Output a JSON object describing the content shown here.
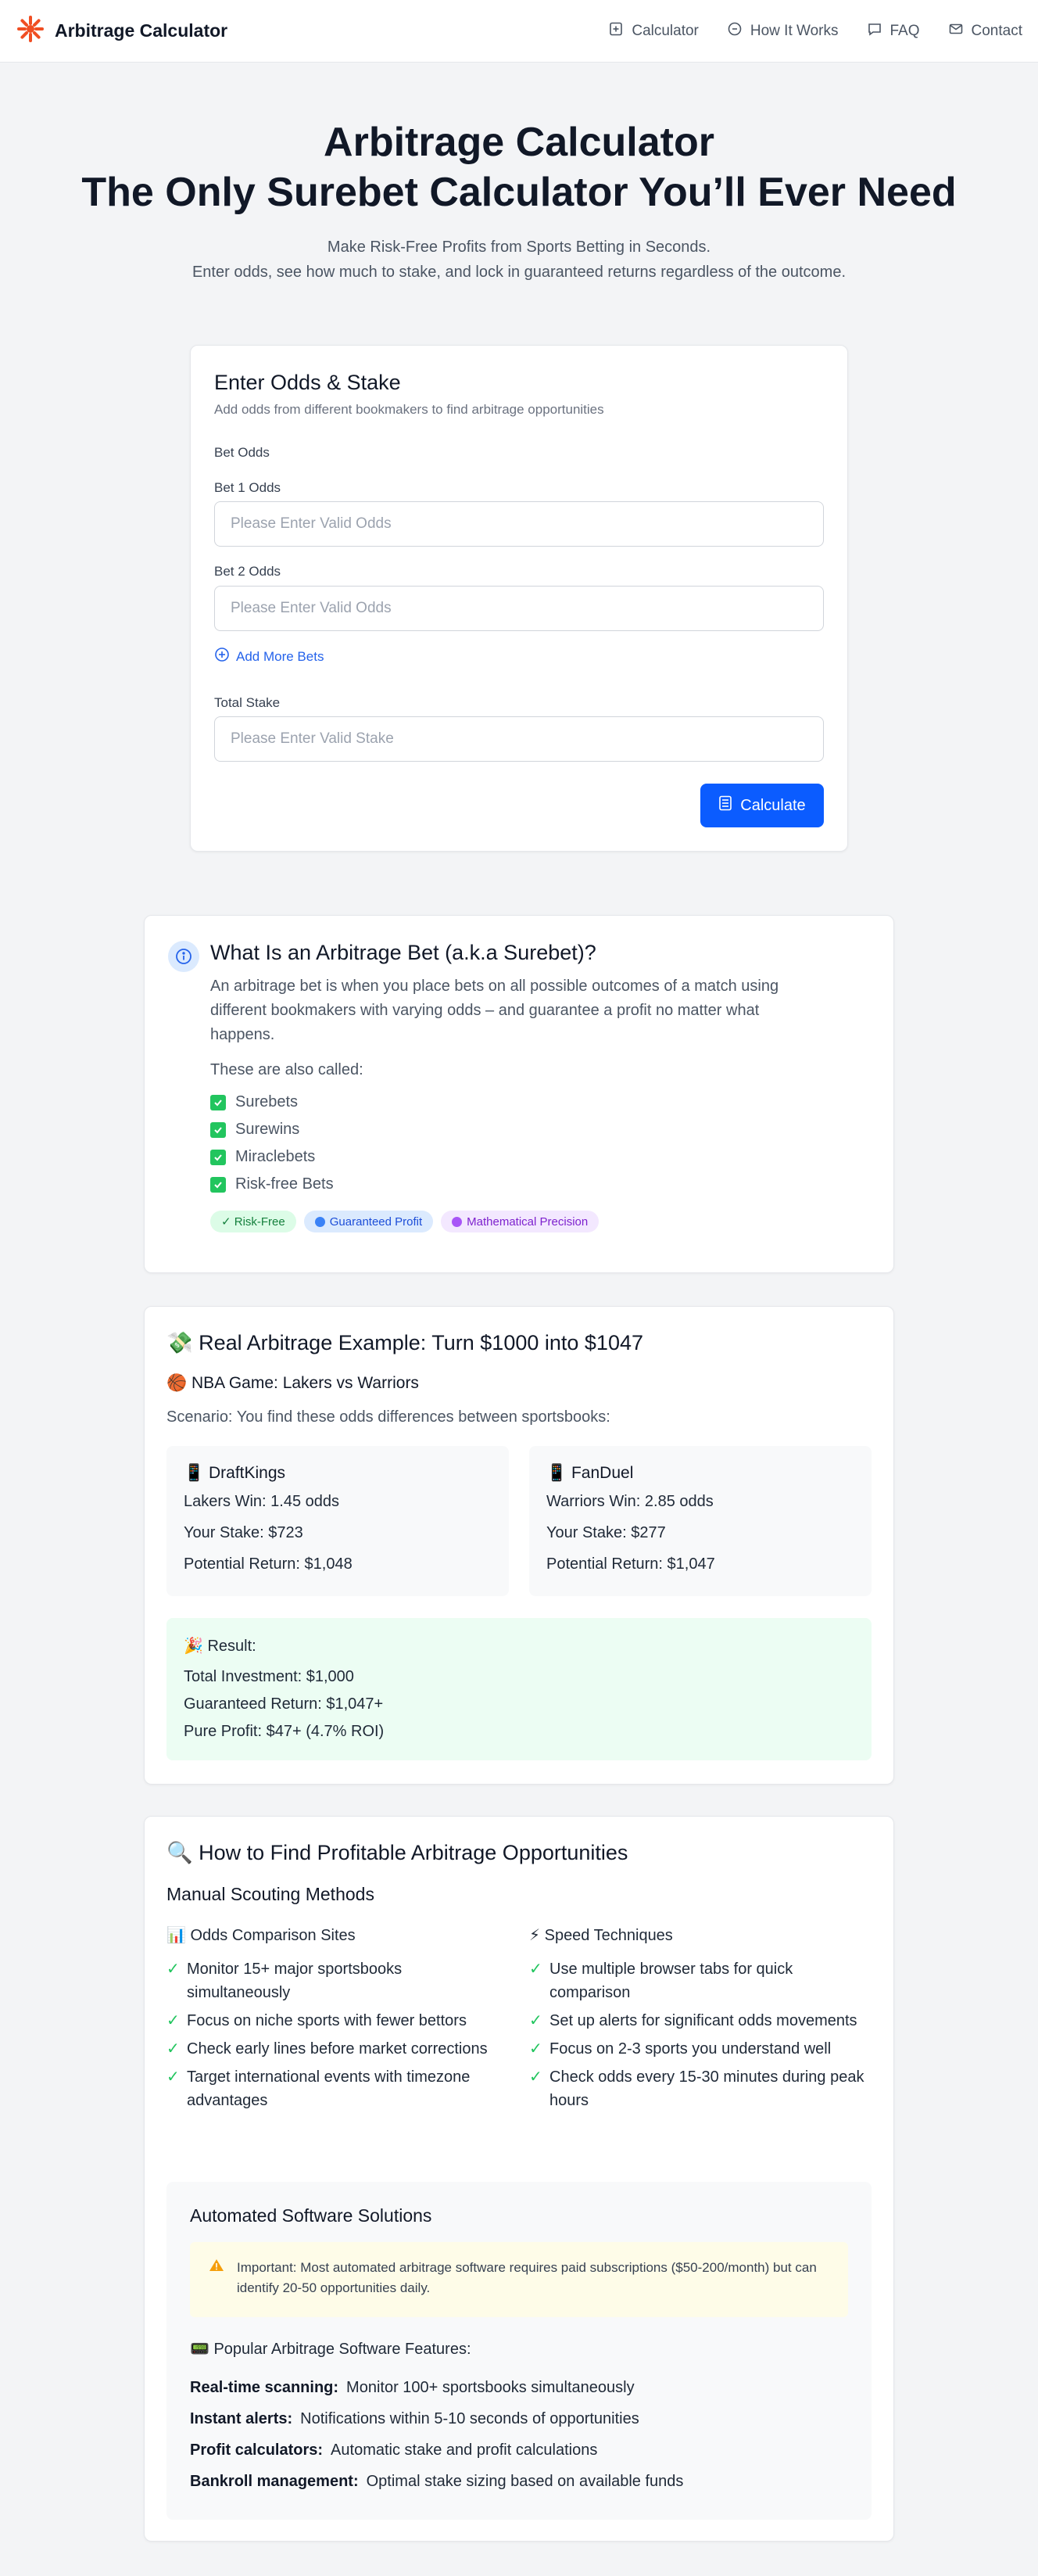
{
  "nav": {
    "brand": "Arbitrage Calculator",
    "links": [
      "Calculator",
      "How It Works",
      "FAQ",
      "Contact"
    ]
  },
  "hero": {
    "title_line1": "Arbitrage Calculator",
    "title_line2": "The Only Surebet Calculator You’ll Ever Need",
    "sub_line1": "Make Risk-Free Profits from Sports Betting in Seconds.",
    "sub_line2": "Enter odds, see how much to stake, and lock in guaranteed returns regardless of the outcome."
  },
  "calculator": {
    "title": "Enter Odds & Stake",
    "description": "Add odds from different bookmakers to find arbitrage opportunities",
    "bet_odds_label": "Bet Odds",
    "bet1_label": "Bet 1 Odds",
    "bet1_placeholder": "Please Enter Valid Odds",
    "bet2_label": "Bet 2 Odds",
    "bet2_placeholder": "Please Enter Valid Odds",
    "add_more": "Add More Bets",
    "stake_label": "Total Stake",
    "stake_placeholder": "Please Enter Valid Stake",
    "calculate": "Calculate"
  },
  "what_is": {
    "title": "What Is an Arbitrage Bet (a.k.a Surebet)?",
    "paragraph": "An arbitrage bet is when you place bets on all possible outcomes of a match using different bookmakers with varying odds – and guarantee a profit no matter what happens.",
    "also_called": "These are also called:",
    "names": [
      "Surebets",
      "Surewins",
      "Miraclebets",
      "Risk-free Bets"
    ],
    "tags": [
      "✓ Risk-Free",
      "Guaranteed Profit",
      "Mathematical Precision"
    ]
  },
  "example": {
    "title": "💸 Real Arbitrage Example: Turn $1000 into $1047",
    "game": "🏀 NBA Game: Lakers vs Warriors",
    "scenario": "Scenario: You find these odds differences between sportsbooks:",
    "books": [
      {
        "name": "📱 DraftKings",
        "win": "Lakers Win: ",
        "odds": "1.45 odds",
        "stake": "Your Stake: $723",
        "return": "Potential Return: $1,048"
      },
      {
        "name": "📱 FanDuel",
        "win": "Warriors Win: ",
        "odds": "2.85 odds",
        "stake": "Your Stake: $277",
        "return": "Potential Return: $1,047"
      }
    ],
    "result_title": "🎉 Result:",
    "result_lines": [
      "Total Investment: $1,000",
      "Guaranteed Return: $1,047+",
      "Pure Profit: $47+ (4.7% ROI)"
    ]
  },
  "how_to": {
    "title": "🔍 How to Find Profitable Arbitrage Opportunities",
    "manual_title": "Manual Scouting Methods",
    "left_title": "📊 Odds Comparison Sites",
    "left_items": [
      "Monitor 15+ major sportsbooks simultaneously",
      "Focus on niche sports with fewer bettors",
      "Check early lines before market corrections",
      "Target international events with timezone advantages"
    ],
    "right_title": "⚡ Speed Techniques",
    "right_items": [
      "Use multiple browser tabs for quick comparison",
      "Set up alerts for significant odds movements",
      "Focus on 2-3 sports you understand well",
      "Check odds every 15-30 minutes during peak hours"
    ],
    "auto_title": "Automated Software Solutions",
    "warning": "Important: Most automated arbitrage software requires paid subscriptions ($50-200/month) but can identify 20-50 opportunities daily.",
    "features_title": "📟 Popular Arbitrage Software Features:",
    "features": [
      {
        "label": "Real-time scanning:",
        "text": "Monitor 100+ sportsbooks simultaneously"
      },
      {
        "label": "Instant alerts:",
        "text": "Notifications within 5-10 seconds of opportunities"
      },
      {
        "label": "Profit calculators:",
        "text": "Automatic stake and profit calculations"
      },
      {
        "label": "Bankroll management:",
        "text": "Optimal stake sizing based on available funds"
      }
    ]
  },
  "colors": {
    "accent": "#0b5cff",
    "logo": "#f04e23",
    "success": "#22c55e"
  }
}
